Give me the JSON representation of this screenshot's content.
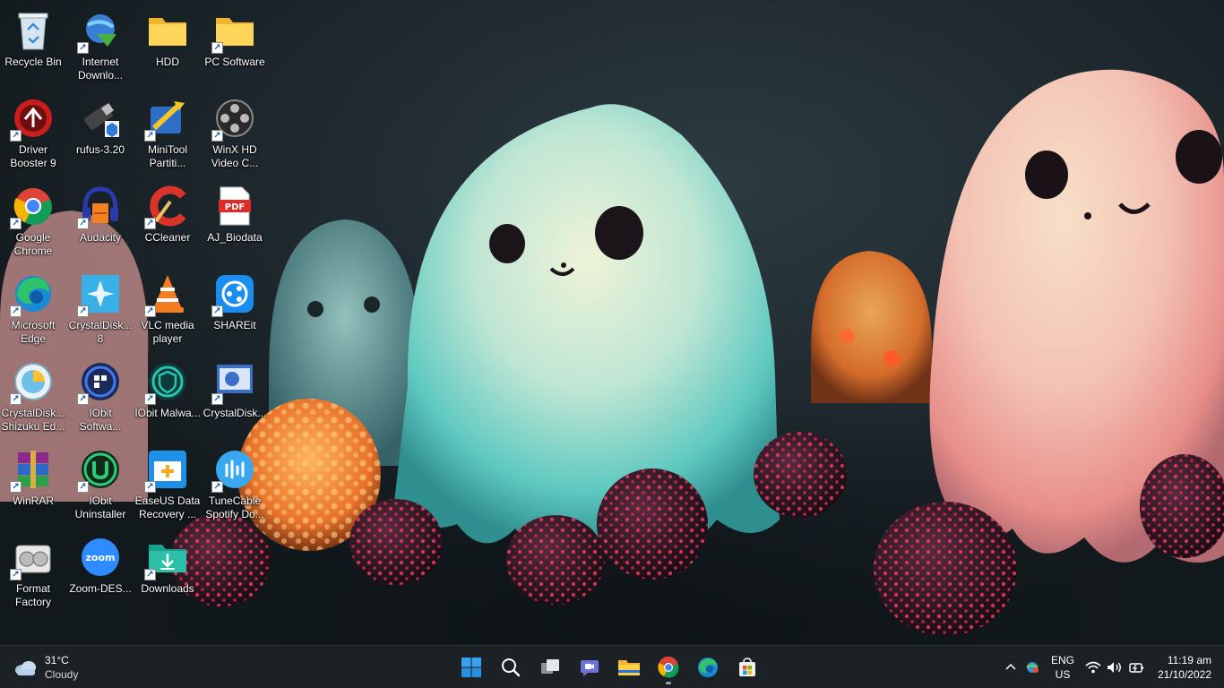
{
  "desktop": {
    "icons": [
      {
        "label": "Recycle Bin",
        "icon": "recycle-bin-icon",
        "shortcut": false
      },
      {
        "label": "Internet Downlo...",
        "icon": "idm-icon",
        "shortcut": true
      },
      {
        "label": "HDD",
        "icon": "folder-icon",
        "shortcut": false
      },
      {
        "label": "PC Software",
        "icon": "folder-icon",
        "shortcut": true
      },
      {
        "label": "Driver Booster 9",
        "icon": "driver-booster-icon",
        "shortcut": true
      },
      {
        "label": "rufus-3.20",
        "icon": "rufus-icon",
        "shortcut": false
      },
      {
        "label": "MiniTool Partiti...",
        "icon": "minitool-icon",
        "shortcut": true
      },
      {
        "label": "WinX HD Video C...",
        "icon": "winx-icon",
        "shortcut": true
      },
      {
        "label": "Google Chrome",
        "icon": "chrome-icon",
        "shortcut": true
      },
      {
        "label": "Audacity",
        "icon": "audacity-icon",
        "shortcut": true
      },
      {
        "label": "CCleaner",
        "icon": "ccleaner-icon",
        "shortcut": true
      },
      {
        "label": "AJ_Biodata",
        "icon": "pdf-icon",
        "shortcut": false
      },
      {
        "label": "Microsoft Edge",
        "icon": "edge-icon",
        "shortcut": true
      },
      {
        "label": "CrystalDisk... 8",
        "icon": "crystaldisk-icon",
        "shortcut": true
      },
      {
        "label": "VLC media player",
        "icon": "vlc-icon",
        "shortcut": true
      },
      {
        "label": "SHAREit",
        "icon": "shareit-icon",
        "shortcut": true
      },
      {
        "label": "CrystalDisk... Shizuku Ed...",
        "icon": "crystaldisk-shizuku-icon",
        "shortcut": true
      },
      {
        "label": "IObit Softwa...",
        "icon": "iobit-software-icon",
        "shortcut": true
      },
      {
        "label": "IObit Malwa...",
        "icon": "iobit-malware-icon",
        "shortcut": true
      },
      {
        "label": "CrystalDisk...",
        "icon": "crystaldisk-info-icon",
        "shortcut": true
      },
      {
        "label": "WinRAR",
        "icon": "winrar-icon",
        "shortcut": true
      },
      {
        "label": "IObit Uninstaller",
        "icon": "iobit-uninstaller-icon",
        "shortcut": true
      },
      {
        "label": "EaseUS Data Recovery ...",
        "icon": "easeus-icon",
        "shortcut": true
      },
      {
        "label": "TuneCable Spotify Do...",
        "icon": "tunecable-icon",
        "shortcut": true
      },
      {
        "label": "Format Factory",
        "icon": "format-factory-icon",
        "shortcut": true
      },
      {
        "label": "Zoom-DES...",
        "icon": "zoom-icon",
        "shortcut": false
      },
      {
        "label": "Downloads",
        "icon": "downloads-folder-icon",
        "shortcut": true
      }
    ]
  },
  "taskbar": {
    "weather": {
      "temp": "31°C",
      "condition": "Cloudy"
    },
    "apps": [
      {
        "name": "start-button",
        "icon": "windows-logo-icon",
        "active": false
      },
      {
        "name": "search-button",
        "icon": "search-icon",
        "active": false
      },
      {
        "name": "task-view-button",
        "icon": "task-view-icon",
        "active": false
      },
      {
        "name": "chat-button",
        "icon": "teams-chat-icon",
        "active": false
      },
      {
        "name": "file-explorer-button",
        "icon": "file-explorer-icon",
        "active": false
      },
      {
        "name": "chrome-taskbar-button",
        "icon": "chrome-icon",
        "active": true
      },
      {
        "name": "edge-taskbar-button",
        "icon": "edge-icon",
        "active": false
      },
      {
        "name": "store-taskbar-button",
        "icon": "microsoft-store-icon",
        "active": false
      }
    ],
    "tray": {
      "lang_top": "ENG",
      "lang_bottom": "US",
      "time": "11:19 am",
      "date": "21/10/2022"
    }
  },
  "colors": {
    "taskbar_bg": "#1c2126",
    "accent": "#0078d4"
  }
}
